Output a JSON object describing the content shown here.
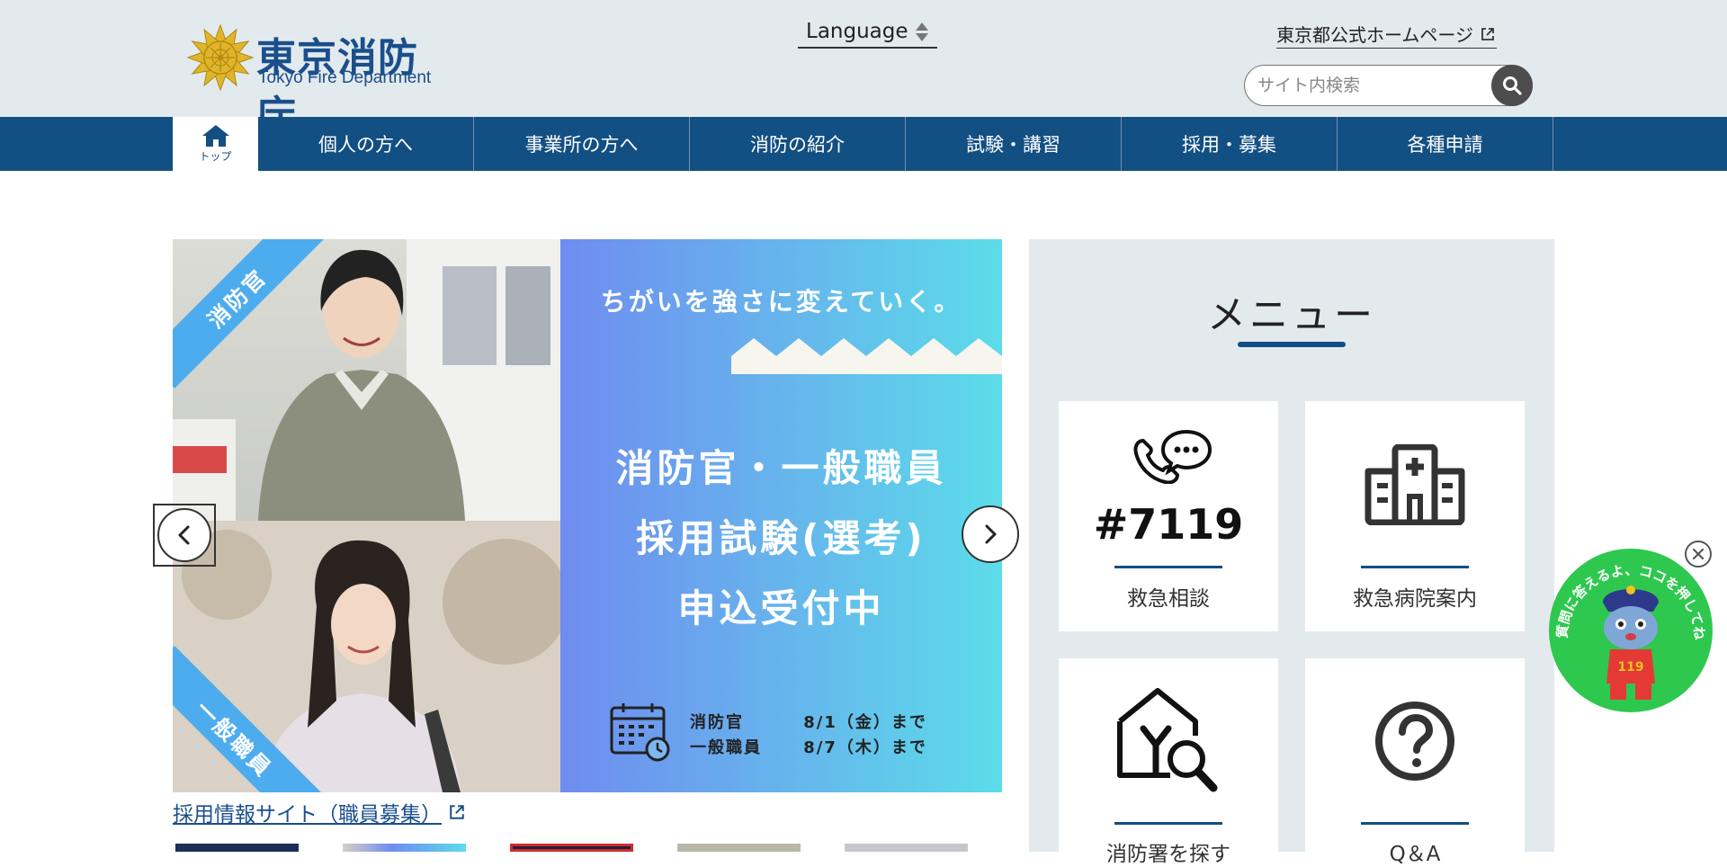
{
  "header": {
    "logo_jp": "東京消防庁",
    "logo_en": "Tokyo Fire Department",
    "language_label": "Language",
    "tokyo_link": "東京都公式ホームページ",
    "search_placeholder": "サイト内検索"
  },
  "nav": {
    "home_label": "トップ",
    "items": [
      "個人の方へ",
      "事業所の方へ",
      "消防の紹介",
      "試験・講習",
      "採用・募集",
      "各種申請"
    ]
  },
  "carousel": {
    "tagline": "ちがいを強さに変えていく。",
    "title_lines": [
      "消防官・一般職員",
      "採用試験(選考)",
      "申込受付中"
    ],
    "ribbon_top": "消防官",
    "ribbon_bottom": "一般職員",
    "schedule": [
      {
        "role": "消防官",
        "deadline": "8/1（金）まで"
      },
      {
        "role": "一般職員",
        "deadline": "8/7（木）まで"
      }
    ],
    "link_text": "採用情報サイト（職員募集）"
  },
  "menu": {
    "title": "メニュー",
    "cards": [
      {
        "label": "救急相談",
        "icon_text": "#7119",
        "icon": "phone-chat-icon"
      },
      {
        "label": "救急病院案内",
        "icon": "hospital-icon"
      },
      {
        "label": "消防署を探す",
        "icon": "house-search-icon"
      },
      {
        "label": "Q＆A",
        "icon": "question-icon"
      }
    ]
  },
  "chatbot": {
    "text": "質問に答えるよ、ココを押してね！",
    "badge": "119"
  },
  "colors": {
    "header_bg": "#e3eaed",
    "nav_bg": "#124f83",
    "logo_blue": "#1a4f8c",
    "logo_gold": "#e0b52a",
    "chatbot_green": "#2ec84f"
  }
}
